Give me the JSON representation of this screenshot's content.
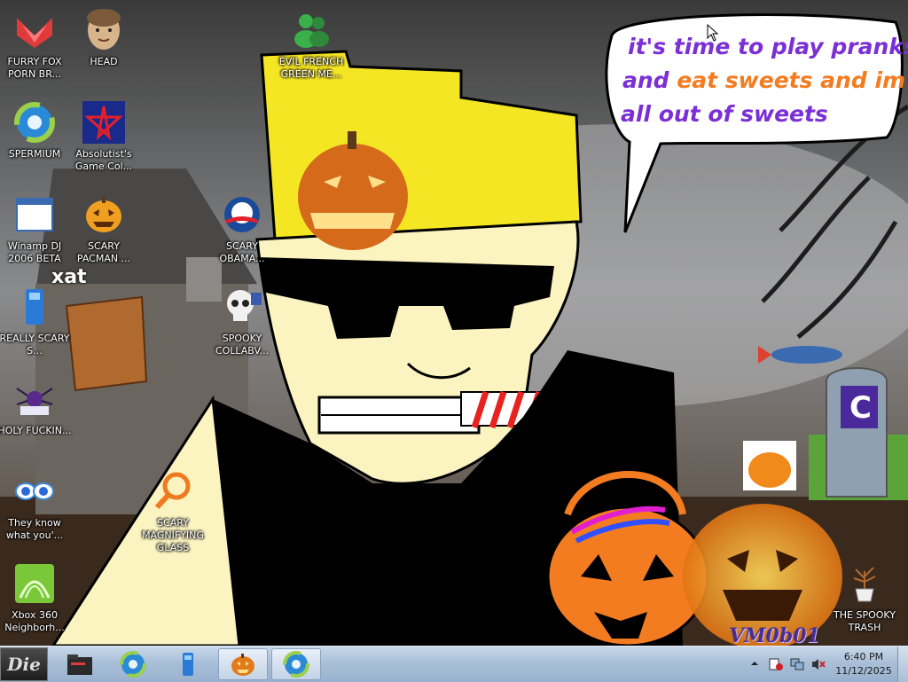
{
  "desktop": {
    "icons": [
      {
        "label": "FURRY FOX PORN BR...",
        "icon": "fox-logo-icon"
      },
      {
        "label": "HEAD",
        "icon": "face-icon"
      },
      {
        "label": "EVIL FRENCH GREEN ME...",
        "icon": "messenger-icon"
      },
      {
        "label": "SPERMIUM",
        "icon": "browser-icon"
      },
      {
        "label": "Absolutist's Game Col...",
        "icon": "star-logo-icon"
      },
      {
        "label": "Winamp DJ 2006 BETA",
        "icon": "window-icon"
      },
      {
        "label": "SCARY PACMAN ...",
        "icon": "jack-o-lantern-icon"
      },
      {
        "label": "SCARY OBAMA...",
        "icon": "obama-logo-icon"
      },
      {
        "label": "REALLY SCARY S...",
        "icon": "usb-drive-icon"
      },
      {
        "label": "SPOOKY COLLABV...",
        "icon": "skull-icon"
      },
      {
        "label": "HOLY FUCKIN...",
        "icon": "spider-icon"
      },
      {
        "label": "They know what you'...",
        "icon": "eyes-icon"
      },
      {
        "label": "SCARY MAGNIFYING GLASS",
        "icon": "magnifier-icon"
      },
      {
        "label": "Xbox 360 Neighborh...",
        "icon": "xbox-icon"
      },
      {
        "label": "THE SPOOKY TRASH",
        "icon": "trash-plant-icon"
      }
    ]
  },
  "wallpaper": {
    "speech_line1": "it's time to play pranks",
    "speech_line2a": "and ",
    "speech_line2b": "eat sweets and im",
    "speech_line3": "all out of sweets",
    "signature": "VM0b01",
    "tombstone_letter": "C",
    "xat_logo": "xat"
  },
  "taskbar": {
    "start_label": "Die",
    "buttons": [
      {
        "name": "folder-icon"
      },
      {
        "name": "browser-icon"
      },
      {
        "name": "usb-drive-icon"
      },
      {
        "name": "jack-o-lantern-icon"
      },
      {
        "name": "browser-icon"
      }
    ],
    "clock_time": "6:40 PM",
    "clock_date": "11/12/2025"
  },
  "colors": {
    "speech_purple": "#7b2fd6",
    "speech_orange": "#f47c20",
    "hat_yellow": "#f5e624",
    "skin": "#fbf3c0"
  }
}
